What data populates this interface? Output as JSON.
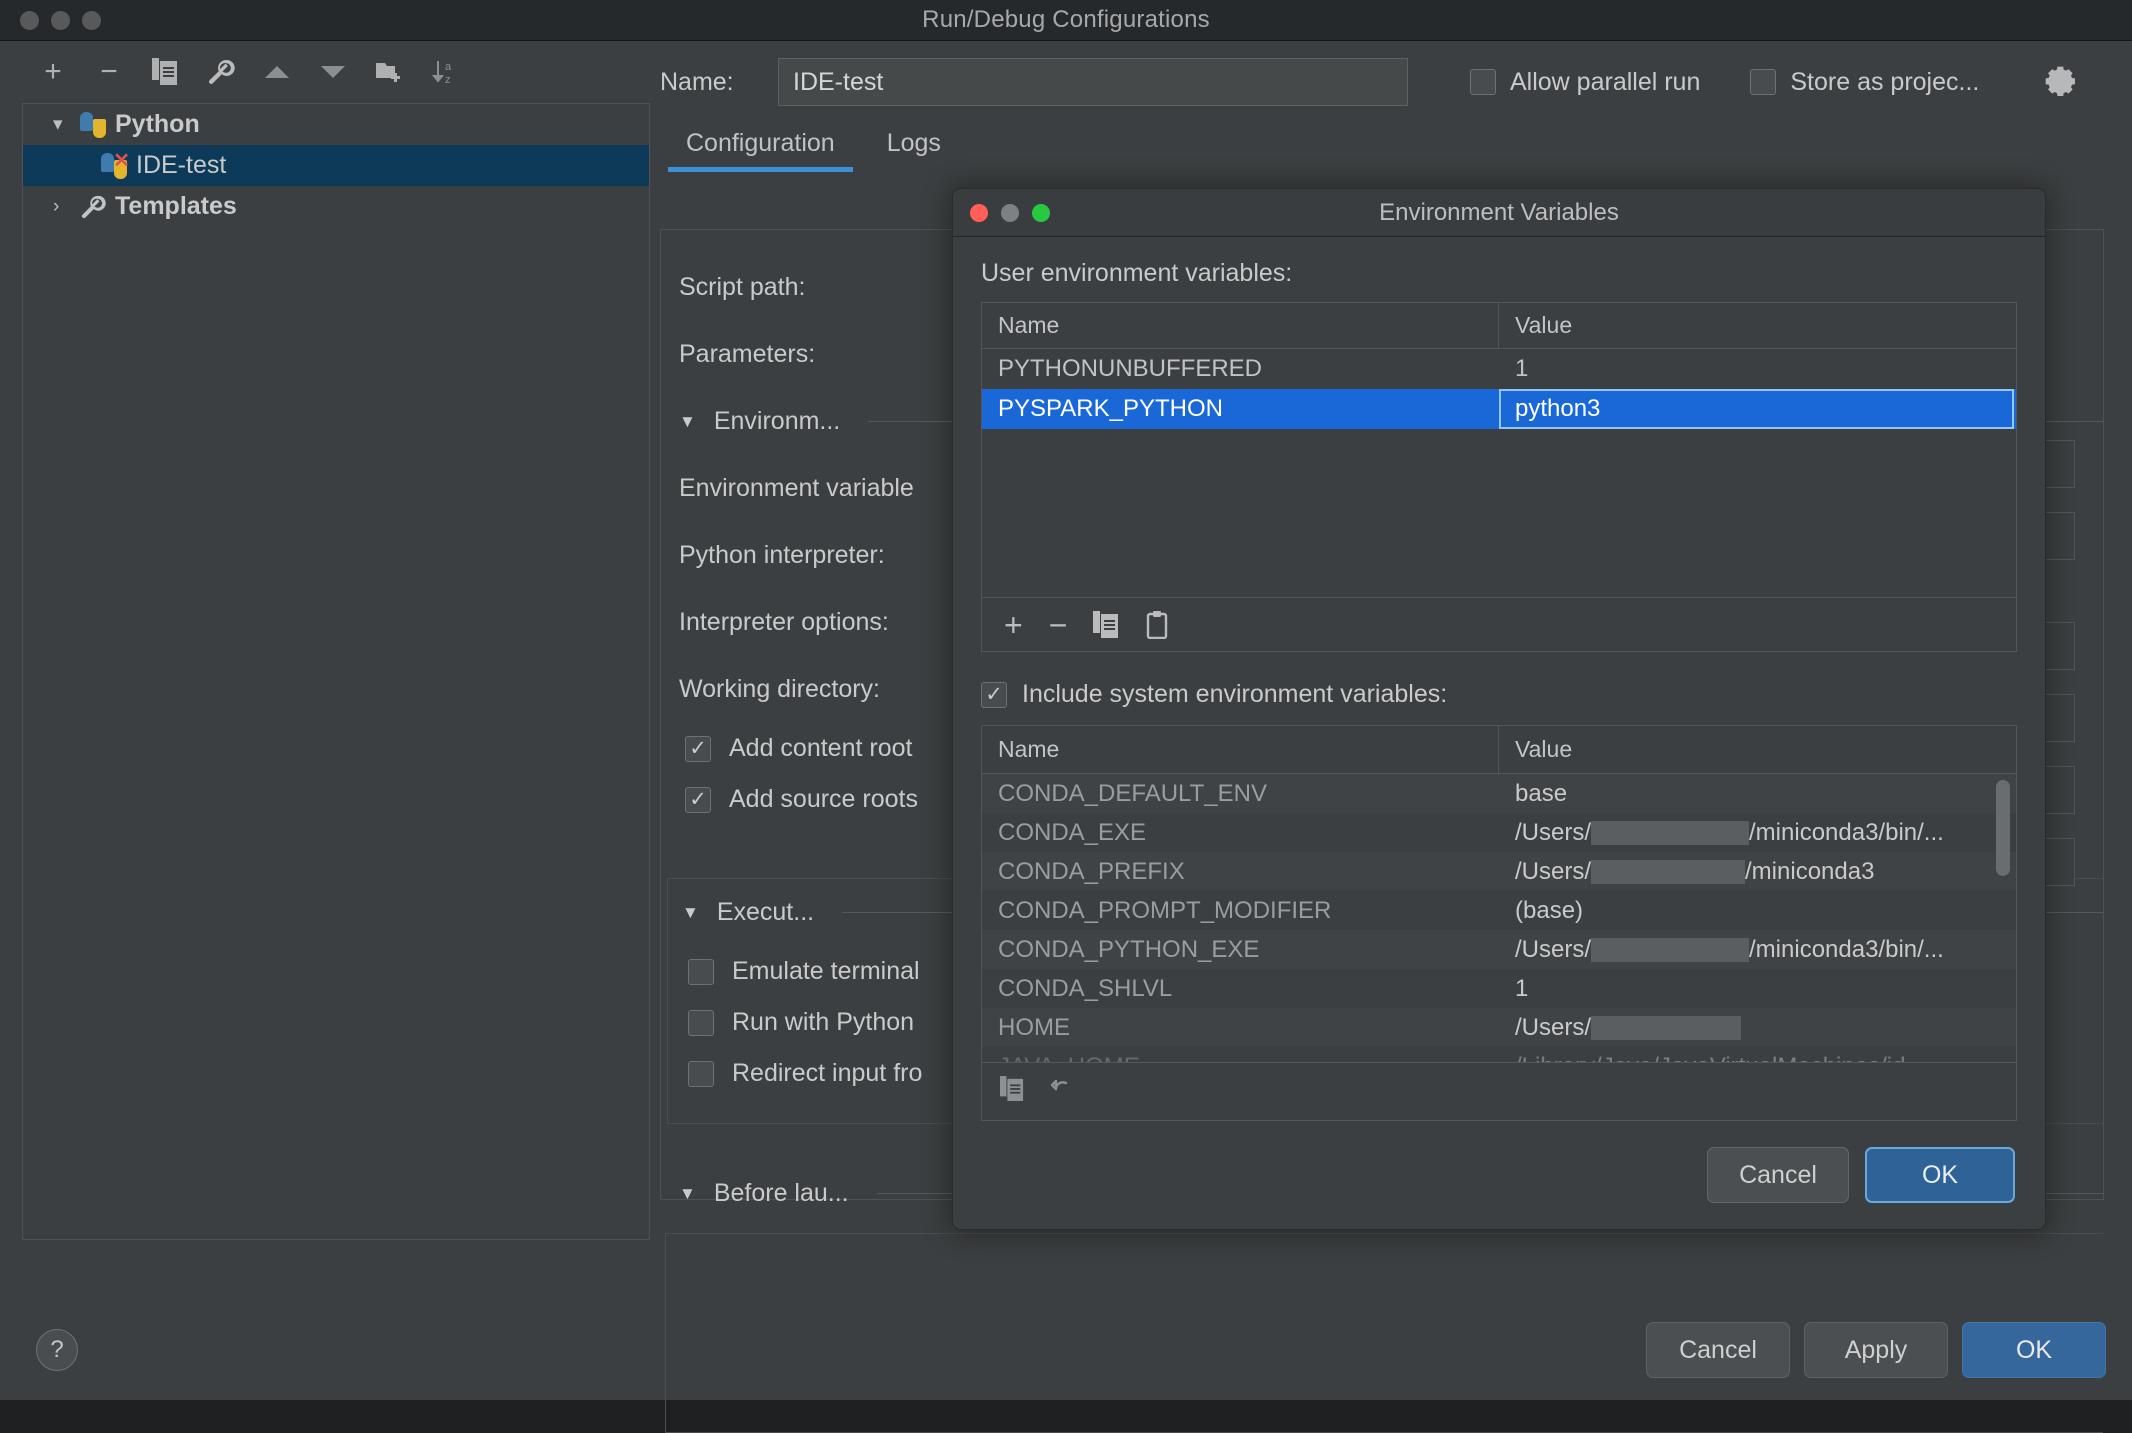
{
  "window": {
    "title": "Run/Debug Configurations",
    "traffic_lights": [
      "close",
      "minimize",
      "zoom"
    ]
  },
  "toolbar": {
    "items": [
      {
        "name": "add-icon",
        "glyph": "+"
      },
      {
        "name": "remove-icon",
        "glyph": "−"
      },
      {
        "name": "copy-icon",
        "glyph": "copy"
      },
      {
        "name": "edit-templates-icon",
        "glyph": "wrench"
      },
      {
        "name": "move-up-icon",
        "glyph": "▲"
      },
      {
        "name": "move-down-icon",
        "glyph": "▼"
      },
      {
        "name": "new-folder-icon",
        "glyph": "folder-plus"
      },
      {
        "name": "sort-alphabetically-icon",
        "glyph": "sort-az"
      }
    ]
  },
  "tree": {
    "nodes": [
      {
        "label": "Python",
        "expanded": true,
        "selected": false,
        "icon": "python-icon",
        "level": 0
      },
      {
        "label": "IDE-test",
        "expanded": null,
        "selected": true,
        "icon": "python-error-icon",
        "level": 1
      },
      {
        "label": "Templates",
        "expanded": false,
        "selected": false,
        "icon": "wrench-icon",
        "level": 0
      }
    ]
  },
  "name_field": {
    "label": "Name:",
    "value": "IDE-test",
    "placeholder": ""
  },
  "top_checkboxes": [
    {
      "label": "Allow parallel run",
      "checked": false
    },
    {
      "label": "Store as projec...",
      "checked": false
    }
  ],
  "gear_button": {
    "name": "gear-icon"
  },
  "tabs": [
    {
      "label": "Configuration",
      "active": true
    },
    {
      "label": "Logs",
      "active": false
    }
  ],
  "config": {
    "fields": [
      {
        "label": "Script path:"
      },
      {
        "label": "Parameters:"
      }
    ],
    "environment_section": {
      "title": "Environm...",
      "expanded": true,
      "fields": [
        {
          "label": "Environment variable"
        },
        {
          "label": "Python interpreter:"
        },
        {
          "label": "Interpreter options:"
        },
        {
          "label": "Working directory:"
        }
      ],
      "checkboxes": [
        {
          "label": "Add content root",
          "checked": true
        },
        {
          "label": "Add source roots",
          "checked": true
        }
      ]
    },
    "execution_section": {
      "title": "Execut...",
      "expanded": true,
      "checkboxes": [
        {
          "label": "Emulate terminal",
          "checked": false
        },
        {
          "label": "Run with Python",
          "checked": false
        },
        {
          "label": "Redirect input fro",
          "checked": false
        }
      ]
    },
    "before_launch_section": {
      "title": "Before lau...",
      "expanded": true
    }
  },
  "bottom_bar": {
    "help_label": "?",
    "buttons": [
      {
        "label": "Cancel",
        "primary": false
      },
      {
        "label": "Apply",
        "primary": false
      },
      {
        "label": "OK",
        "primary": true
      }
    ]
  },
  "env_dialog": {
    "title": "Environment Variables",
    "user_section_label": "User environment variables:",
    "user_table": {
      "columns": [
        "Name",
        "Value"
      ],
      "rows": [
        {
          "name": "PYTHONUNBUFFERED",
          "value": "1",
          "selected": false,
          "editing": false
        },
        {
          "name": "PYSPARK_PYTHON",
          "value": "python3",
          "selected": true,
          "editing": true
        }
      ]
    },
    "user_toolbar": [
      {
        "name": "add-variable-icon",
        "glyph": "+"
      },
      {
        "name": "remove-variable-icon",
        "glyph": "−"
      },
      {
        "name": "copy-variable-icon",
        "glyph": "copy"
      },
      {
        "name": "paste-variable-icon",
        "glyph": "paste"
      }
    ],
    "include_system": {
      "label": "Include system environment variables:",
      "checked": true
    },
    "system_table": {
      "columns": [
        "Name",
        "Value"
      ],
      "rows": [
        {
          "name": "CONDA_DEFAULT_ENV",
          "value_before": "base",
          "redacted": false,
          "value_after": ""
        },
        {
          "name": "CONDA_EXE",
          "value_before": "/Users/",
          "redacted": true,
          "value_after": "/miniconda3/bin/..."
        },
        {
          "name": "CONDA_PREFIX",
          "value_before": "/Users/",
          "redacted": true,
          "value_after": "/miniconda3"
        },
        {
          "name": "CONDA_PROMPT_MODIFIER",
          "value_before": "(base)",
          "redacted": false,
          "value_after": ""
        },
        {
          "name": "CONDA_PYTHON_EXE",
          "value_before": "/Users/",
          "redacted": true,
          "value_after": "/miniconda3/bin/..."
        },
        {
          "name": "CONDA_SHLVL",
          "value_before": "1",
          "redacted": false,
          "value_after": ""
        },
        {
          "name": "HOME",
          "value_before": "/Users/",
          "redacted": true,
          "value_after": ""
        },
        {
          "name": "JAVA_HOME",
          "value_before": "/Library/Java/JavaVirtualMachines/jd",
          "redacted": false,
          "value_after": ""
        }
      ]
    },
    "system_toolbar": [
      {
        "name": "copy-icon",
        "glyph": "copy"
      },
      {
        "name": "revert-icon",
        "glyph": "undo"
      }
    ],
    "buttons": [
      {
        "label": "Cancel",
        "primary": false
      },
      {
        "label": "OK",
        "primary": true
      }
    ]
  },
  "colors": {
    "window_bg": "#3c3f41",
    "titlebar_bg": "#26292b",
    "accent_blue": "#3b91d6",
    "selection_blue": "#1a68d8",
    "tree_selection": "#0d3a58",
    "primary_button": "#35679c",
    "text": "#c8cacb",
    "muted_text": "#9a9d9f"
  }
}
